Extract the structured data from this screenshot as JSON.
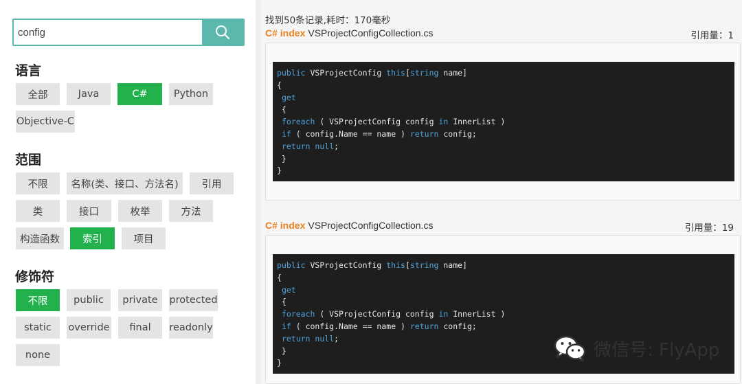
{
  "search": {
    "value": "config",
    "button_icon": "search-icon"
  },
  "filters": {
    "language": {
      "title": "语言",
      "options": [
        {
          "label": "全部",
          "active": false
        },
        {
          "label": "Java",
          "active": false
        },
        {
          "label": "C#",
          "active": true
        },
        {
          "label": "Python",
          "active": false
        },
        {
          "label": "Objective-C",
          "active": false
        }
      ]
    },
    "scope": {
      "title": "范围",
      "options": [
        {
          "label": "不限",
          "active": false
        },
        {
          "label": "名称(类、接口、方法名)",
          "active": false
        },
        {
          "label": "引用",
          "active": false
        },
        {
          "label": "类",
          "active": false
        },
        {
          "label": "接口",
          "active": false
        },
        {
          "label": "枚举",
          "active": false
        },
        {
          "label": "方法",
          "active": false
        },
        {
          "label": "构造函数",
          "active": false
        },
        {
          "label": "索引",
          "active": true
        },
        {
          "label": "项目",
          "active": false
        }
      ]
    },
    "modifier": {
      "title": "修饰符",
      "options": [
        {
          "label": "不限",
          "active": true
        },
        {
          "label": "public",
          "active": false
        },
        {
          "label": "private",
          "active": false
        },
        {
          "label": "protected",
          "active": false
        },
        {
          "label": "static",
          "active": false
        },
        {
          "label": "override",
          "active": false
        },
        {
          "label": "final",
          "active": false
        },
        {
          "label": "readonly",
          "active": false
        },
        {
          "label": "none",
          "active": false
        }
      ]
    }
  },
  "results": {
    "summary": "找到50条记录,耗时：170毫秒",
    "items": [
      {
        "kind": "C# index",
        "file": "VSProjectConfigCollection.cs",
        "refs": "引用量：1",
        "code": [
          "public VSProjectConfig this[string name]",
          "{",
          " get",
          " {",
          " foreach ( VSProjectConfig config in InnerList )",
          " if ( config.Name == name ) return config;",
          " return null;",
          " }",
          "}"
        ]
      },
      {
        "kind": "C# index",
        "file": "VSProjectConfigCollection.cs",
        "refs": "引用量：19",
        "code": [
          "public VSProjectConfig this[string name]",
          "{",
          " get",
          " {",
          " foreach ( VSProjectConfig config in InnerList )",
          " if ( config.Name == name ) return config;",
          " return null;",
          " }",
          "}"
        ]
      }
    ]
  },
  "watermark": {
    "text": "微信号: FlyApp",
    "icon": "wechat-icon"
  },
  "colors": {
    "accent_teal": "#5cb8ad",
    "active_green": "#22b14c",
    "kind_orange": "#e8821e",
    "keyword_blue": "#4fa4dc",
    "code_bg": "#1e1e1e"
  }
}
